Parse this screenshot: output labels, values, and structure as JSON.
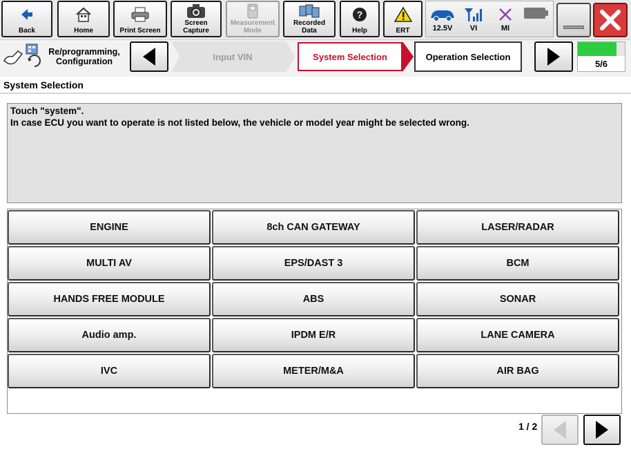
{
  "toolbar": {
    "back": "Back",
    "home": "Home",
    "print_screen": "Print Screen",
    "screen_capture": "Screen Capture",
    "measurement_mode": "Measurement Mode",
    "recorded_data": "Recorded Data",
    "help": "Help",
    "ert": "ERT"
  },
  "status": {
    "voltage": "12.5V",
    "vi": "VI",
    "mi": "MI"
  },
  "nav": {
    "section_label": "Re/programming, Configuration",
    "steps": [
      "Input VIN",
      "System Selection",
      "Operation Selection"
    ],
    "progress": "5/6",
    "progress_fraction": 0.83
  },
  "page": {
    "title": "System Selection",
    "instructions": [
      "Touch \"system\".",
      "In case ECU you want to operate is not listed below, the vehicle or model year might be selected wrong."
    ]
  },
  "systems": [
    "ENGINE",
    "8ch CAN GATEWAY",
    "LASER/RADAR",
    "MULTI AV",
    "EPS/DAST 3",
    "BCM",
    "HANDS FREE MODULE",
    "ABS",
    "SONAR",
    "Audio amp.",
    "IPDM E/R",
    "LANE CAMERA",
    "IVC",
    "METER/M&A",
    "AIR BAG"
  ],
  "pagination": {
    "label": "1 / 2"
  },
  "colors": {
    "active_step": "#c8102e",
    "progress_green": "#2ecc40",
    "close_red": "#d93a3a",
    "icon_blue": "#1a5fb4",
    "warn_yellow": "#f5d90a"
  }
}
